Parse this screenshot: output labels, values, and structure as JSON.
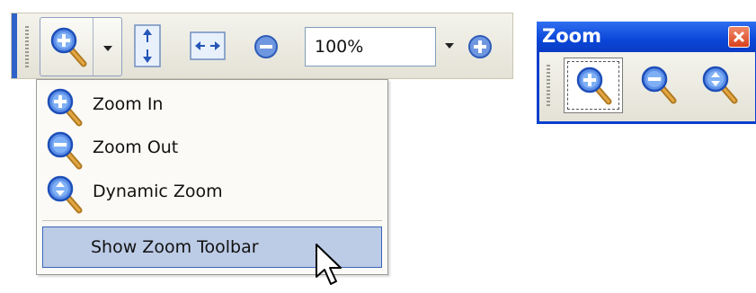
{
  "toolbar": {
    "zoom_value": "100%",
    "buttons": [
      {
        "name": "zoom-in",
        "icon": "magnifier-plus-icon"
      },
      {
        "name": "zoom-menu-arrow",
        "icon": "chevron-down-icon"
      },
      {
        "name": "fit-page",
        "icon": "fit-page-icon"
      },
      {
        "name": "fit-width",
        "icon": "fit-width-icon"
      },
      {
        "name": "zoom-out",
        "icon": "minus-circle-icon"
      },
      {
        "name": "zoom-dropdown",
        "icon": "chevron-down-icon"
      },
      {
        "name": "zoom-in-small",
        "icon": "plus-circle-icon"
      }
    ]
  },
  "menu": {
    "items": [
      {
        "label": "Zoom In",
        "icon": "magnifier-plus-icon"
      },
      {
        "label": "Zoom Out",
        "icon": "magnifier-minus-icon"
      },
      {
        "label": "Dynamic Zoom",
        "icon": "magnifier-dynamic-icon"
      },
      {
        "label": "Show Zoom Toolbar",
        "highlighted": true
      }
    ]
  },
  "zoom_window": {
    "title": "Zoom",
    "buttons": [
      {
        "name": "zoom-in",
        "icon": "magnifier-plus-icon",
        "active": true
      },
      {
        "name": "zoom-out",
        "icon": "magnifier-minus-icon"
      },
      {
        "name": "dynamic-zoom",
        "icon": "magnifier-dynamic-icon"
      }
    ]
  },
  "colors": {
    "accent_bar": "#2f62c8",
    "titlebar": "#0b46d8",
    "menu_highlight": "#bccbe6",
    "close_button": "#d8401c",
    "magnifier_lens": "#2f6fe0",
    "magnifier_handle": "#c98a2a"
  }
}
